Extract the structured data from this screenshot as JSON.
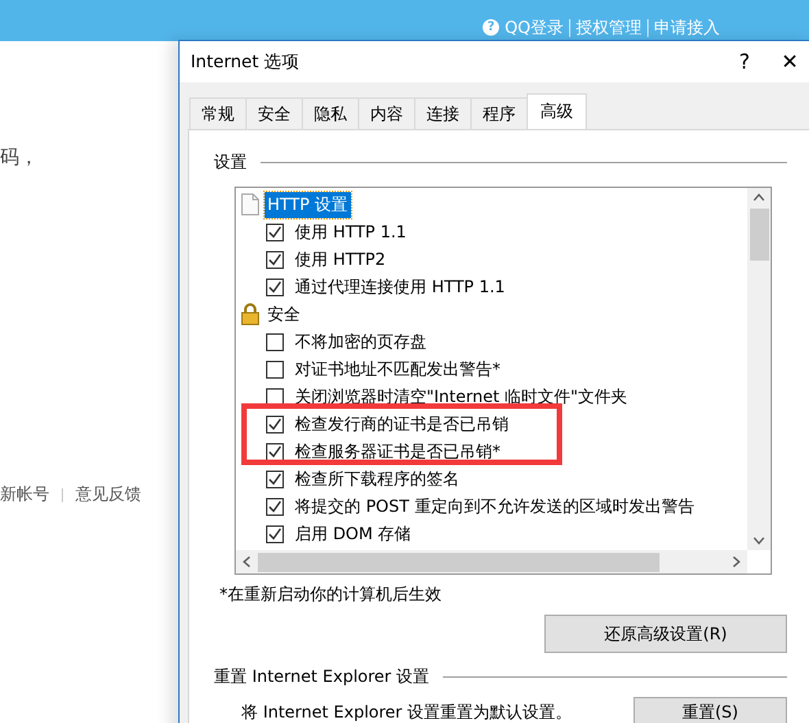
{
  "page": {
    "help_icon": "?",
    "top_links": [
      "QQ登录",
      "授权管理",
      "申请接入"
    ],
    "fragment_text": "码，",
    "footer_links": [
      "新帐号",
      "意见反馈"
    ]
  },
  "dialog": {
    "title": "Internet 选项",
    "help": "?",
    "close": "✕",
    "tabs": [
      {
        "label": "常规",
        "selected": false
      },
      {
        "label": "安全",
        "selected": false
      },
      {
        "label": "隐私",
        "selected": false
      },
      {
        "label": "内容",
        "selected": false
      },
      {
        "label": "连接",
        "selected": false
      },
      {
        "label": "程序",
        "selected": false
      },
      {
        "label": "高级",
        "selected": true
      }
    ],
    "settings_label": "设置",
    "settings": [
      {
        "kind": "group",
        "label": "HTTP 设置",
        "selected": true
      },
      {
        "kind": "checkbox",
        "label": "使用 HTTP 1.1",
        "checked": true
      },
      {
        "kind": "checkbox",
        "label": "使用 HTTP2",
        "checked": true
      },
      {
        "kind": "checkbox",
        "label": "通过代理连接使用 HTTP 1.1",
        "checked": true
      },
      {
        "kind": "group",
        "label": "安全",
        "selected": false
      },
      {
        "kind": "checkbox",
        "label": "不将加密的页存盘",
        "checked": false
      },
      {
        "kind": "checkbox",
        "label": "对证书地址不匹配发出警告*",
        "checked": false
      },
      {
        "kind": "checkbox",
        "label": "关闭浏览器时清空\"Internet 临时文件\"文件夹",
        "checked": false
      },
      {
        "kind": "checkbox",
        "label": "检查发行商的证书是否已吊销",
        "checked": true
      },
      {
        "kind": "checkbox",
        "label": "检查服务器证书是否已吊销*",
        "checked": true
      },
      {
        "kind": "checkbox",
        "label": "检查所下载程序的签名",
        "checked": true
      },
      {
        "kind": "checkbox",
        "label": "将提交的 POST 重定向到不允许发送的区域时发出警告",
        "checked": true
      },
      {
        "kind": "checkbox",
        "label": "启用 DOM 存储",
        "checked": true
      }
    ],
    "note": "*在重新启动你的计算机后生效",
    "restore_button": "还原高级设置(R)",
    "reset_section": "重置 Internet Explorer 设置",
    "reset_text": "将 Internet Explorer 设置重置为默认设置。",
    "reset_button": "重置(S)"
  }
}
